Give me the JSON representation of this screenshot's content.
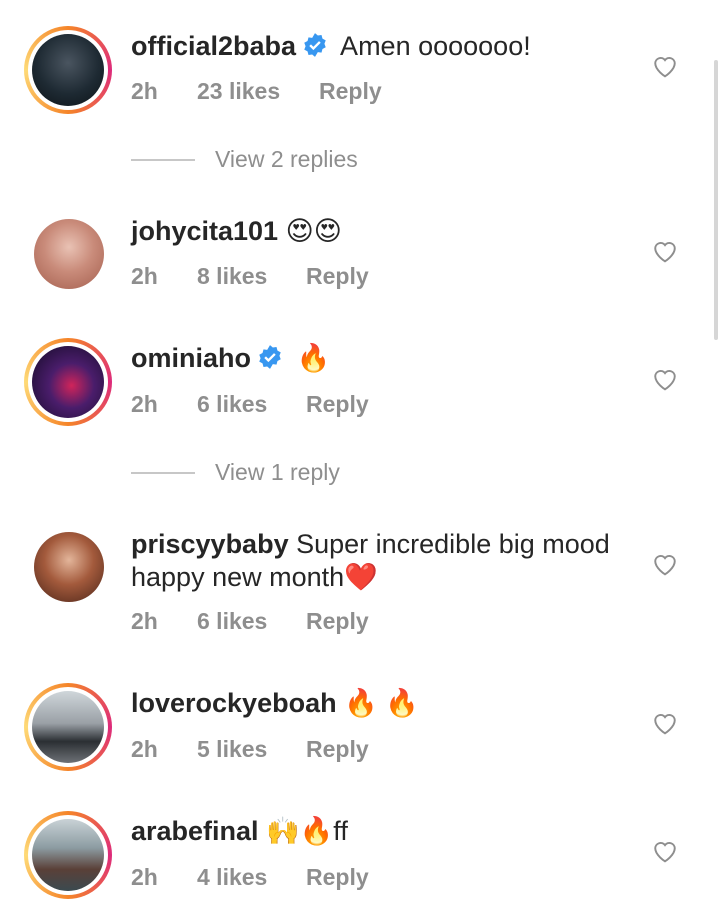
{
  "comments": [
    {
      "username": "official2baba",
      "verified": true,
      "text": " Amen ooooooo!",
      "time": "2h",
      "likes": "23 likes",
      "reply": "Reply",
      "story_ring": true,
      "avatar_color": "#1e2a33"
    },
    {
      "username": "johycita101",
      "verified": false,
      "text": " 😍😍",
      "time": "2h",
      "likes": "8 likes",
      "reply": "Reply",
      "story_ring": false,
      "avatar_color": "#c98b7a"
    },
    {
      "username": "ominiaho",
      "verified": true,
      "text": " 🔥",
      "time": "2h",
      "likes": "6 likes",
      "reply": "Reply",
      "story_ring": true,
      "avatar_color": "#2a1740"
    },
    {
      "username": "priscyybaby",
      "verified": false,
      "text": " Super incredible big mood happy new month❤️",
      "time": "2h",
      "likes": "6 likes",
      "reply": "Reply",
      "story_ring": false,
      "avatar_color": "#7a3b2a"
    },
    {
      "username": "loverockyeboah",
      "verified": false,
      "text": " 🔥 🔥",
      "time": "2h",
      "likes": "5 likes",
      "reply": "Reply",
      "story_ring": true,
      "avatar_color": "#9aa0a6"
    },
    {
      "username": "arabefinal",
      "verified": false,
      "text": " 🙌🔥ff",
      "time": "2h",
      "likes": "4 likes",
      "reply": "Reply",
      "story_ring": true,
      "avatar_color": "#6b7f86"
    }
  ],
  "view_replies": [
    {
      "label": "View 2 replies"
    },
    {
      "label": "View 1 reply"
    }
  ],
  "colors": {
    "text": "#262626",
    "muted": "#8e8e8e",
    "verified": "#3897f0",
    "story_ring": "#dd2a7b"
  }
}
